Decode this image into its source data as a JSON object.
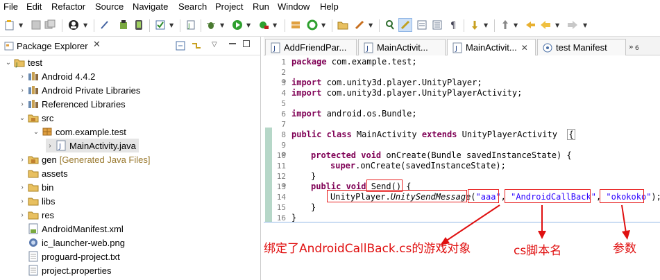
{
  "menu": [
    "File",
    "Edit",
    "Refactor",
    "Source",
    "Navigate",
    "Search",
    "Project",
    "Run",
    "Window",
    "Help"
  ],
  "package_explorer": {
    "title": "Package Explorer",
    "tree": [
      {
        "label": "test",
        "extra": "",
        "icon": "project-icon"
      },
      {
        "label": "Android 4.4.2",
        "extra": "",
        "icon": "library-icon"
      },
      {
        "label": "Android Private Libraries",
        "extra": "",
        "icon": "library-icon"
      },
      {
        "label": "Referenced Libraries",
        "extra": "",
        "icon": "library-icon"
      },
      {
        "label": "src",
        "extra": "",
        "icon": "source-folder-icon"
      },
      {
        "label": "com.example.test",
        "extra": "",
        "icon": "package-icon"
      },
      {
        "label": "MainActivity.java",
        "extra": "",
        "icon": "java-file-icon"
      },
      {
        "label": "gen",
        "extra": "[Generated Java Files]",
        "icon": "source-folder-icon"
      },
      {
        "label": "assets",
        "extra": "",
        "icon": "folder-icon"
      },
      {
        "label": "bin",
        "extra": "",
        "icon": "folder-icon"
      },
      {
        "label": "libs",
        "extra": "",
        "icon": "folder-icon"
      },
      {
        "label": "res",
        "extra": "",
        "icon": "folder-icon"
      },
      {
        "label": "AndroidManifest.xml",
        "extra": "",
        "icon": "xml-file-icon"
      },
      {
        "label": "ic_launcher-web.png",
        "extra": "",
        "icon": "image-file-icon"
      },
      {
        "label": "proguard-project.txt",
        "extra": "",
        "icon": "text-file-icon"
      },
      {
        "label": "project.properties",
        "extra": "",
        "icon": "text-file-icon"
      }
    ]
  },
  "editor_tabs": [
    {
      "label": "AddFriendPar..."
    },
    {
      "label": "MainActivit..."
    },
    {
      "label": "MainActivit..."
    },
    {
      "label": "test Manifest"
    }
  ],
  "overflow_count": "6",
  "code_lines": {
    "n": [
      "1",
      "2",
      "3",
      "4",
      "5",
      "6",
      "7",
      "8",
      "9",
      "10",
      "11",
      "12",
      "13",
      "14",
      "15",
      "16"
    ],
    "l1_kw": "package",
    "l1_rest": " com.example.test;",
    "l3_kw": "import",
    "l3_rest": " com.unity3d.player.UnityPlayer;",
    "l4_kw": "import",
    "l4_rest": " com.unity3d.player.UnityPlayerActivity;",
    "l6_kw": "import",
    "l6_rest": " android.os.Bundle;",
    "l8_kw1": "public class",
    "l8_mid": " MainActivity ",
    "l8_kw2": "extends",
    "l8_rest": " UnityPlayerActivity  ",
    "l8_brace": "{",
    "l10_kw": "protected void",
    "l10_rest": " onCreate(Bundle savedInstanceState) {",
    "l11_kw": "super",
    "l11_rest": ".onCreate(savedInstanceState);",
    "l12": "}",
    "l13_kw": "public void",
    "l13_method": "Send()",
    "l13_rest": " {",
    "l14_obj": "UnityPlayer.",
    "l14_method": "UnitySendMessage",
    "l14_open": "(",
    "l14_s1": "\"aaa\"",
    "l14_comma1": ", ",
    "l14_s2": "\"AndroidCallBack\"",
    "l14_comma2": ", ",
    "l14_s3": "\"okokoko\"",
    "l14_close": ");",
    "l15": "}",
    "l16": "}"
  },
  "annotations": {
    "game_object": "绑定了AndroidCallBack.cs的游戏对象",
    "script_name": "cs脚本名",
    "param": "参数"
  },
  "colors": {
    "annotation": "#e01010",
    "keyword": "#7f0055",
    "string": "#2a00ff"
  }
}
